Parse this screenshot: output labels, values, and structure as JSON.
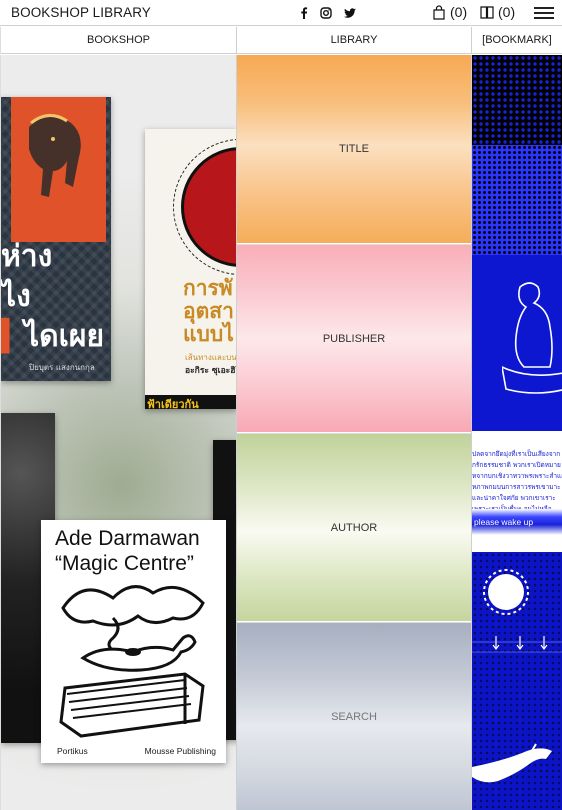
{
  "header": {
    "logo": "BOOKSHOP LIBRARY",
    "cart_count": "(0)",
    "bookmark_count": "(0)",
    "icons": [
      "facebook-icon",
      "instagram-icon",
      "twitter-icon",
      "bag-icon",
      "book-icon",
      "menu-icon"
    ]
  },
  "columns": {
    "bookshop": "BOOKSHOP",
    "library": "LIBRARY",
    "bookmark": "[BOOKMARK]"
  },
  "library_panels": [
    "TITLE",
    "PUBLISHER",
    "AUTHOR",
    "SEARCH"
  ],
  "books": {
    "book1": {
      "title_lines": [
        "ห่าง",
        "ไง",
        "ไดเผย"
      ],
      "author": "ปิยบุตร แสงกนกกุล"
    },
    "book2": {
      "title_lines": [
        "การพั",
        "อุตสา",
        "แบบไ"
      ],
      "sub": "เส้นทางและบนกาศของ",
      "author": "อะกิระ ซุเอะฮิโระ",
      "publisher": "ฟ้าเดียวกัน"
    },
    "book5": {
      "title_line1": "Ade Darmawan",
      "title_line2": "“Magic Centre”",
      "publisher_left": "Portikus",
      "publisher_right": "Mousse Publishing"
    }
  },
  "bookmark": {
    "text_lines": [
      "ปลดจากยึดมุ่งที่เราเป็นเสียงจาก",
      "กรักธรรมชาติ พวกเราเปิดหมาย",
      "หจากบกเชิงวาทวาพรเพราะสำแก",
      "หภาพกมบนการสาวรพรเขามาะ",
      "และน่าคาใจศกัย พวกเขาเราะ",
      "เพราะเราเป็นชื่นๆ จนไม่หลือ"
    ],
    "wake": "please wake up"
  },
  "colors": {
    "bookmark_blue": "#1a22d8",
    "title_panel": "#f7a952",
    "publisher_panel": "#f9aeb8",
    "author_panel": "#c0d29a",
    "search_panel": "#a7afc0"
  }
}
